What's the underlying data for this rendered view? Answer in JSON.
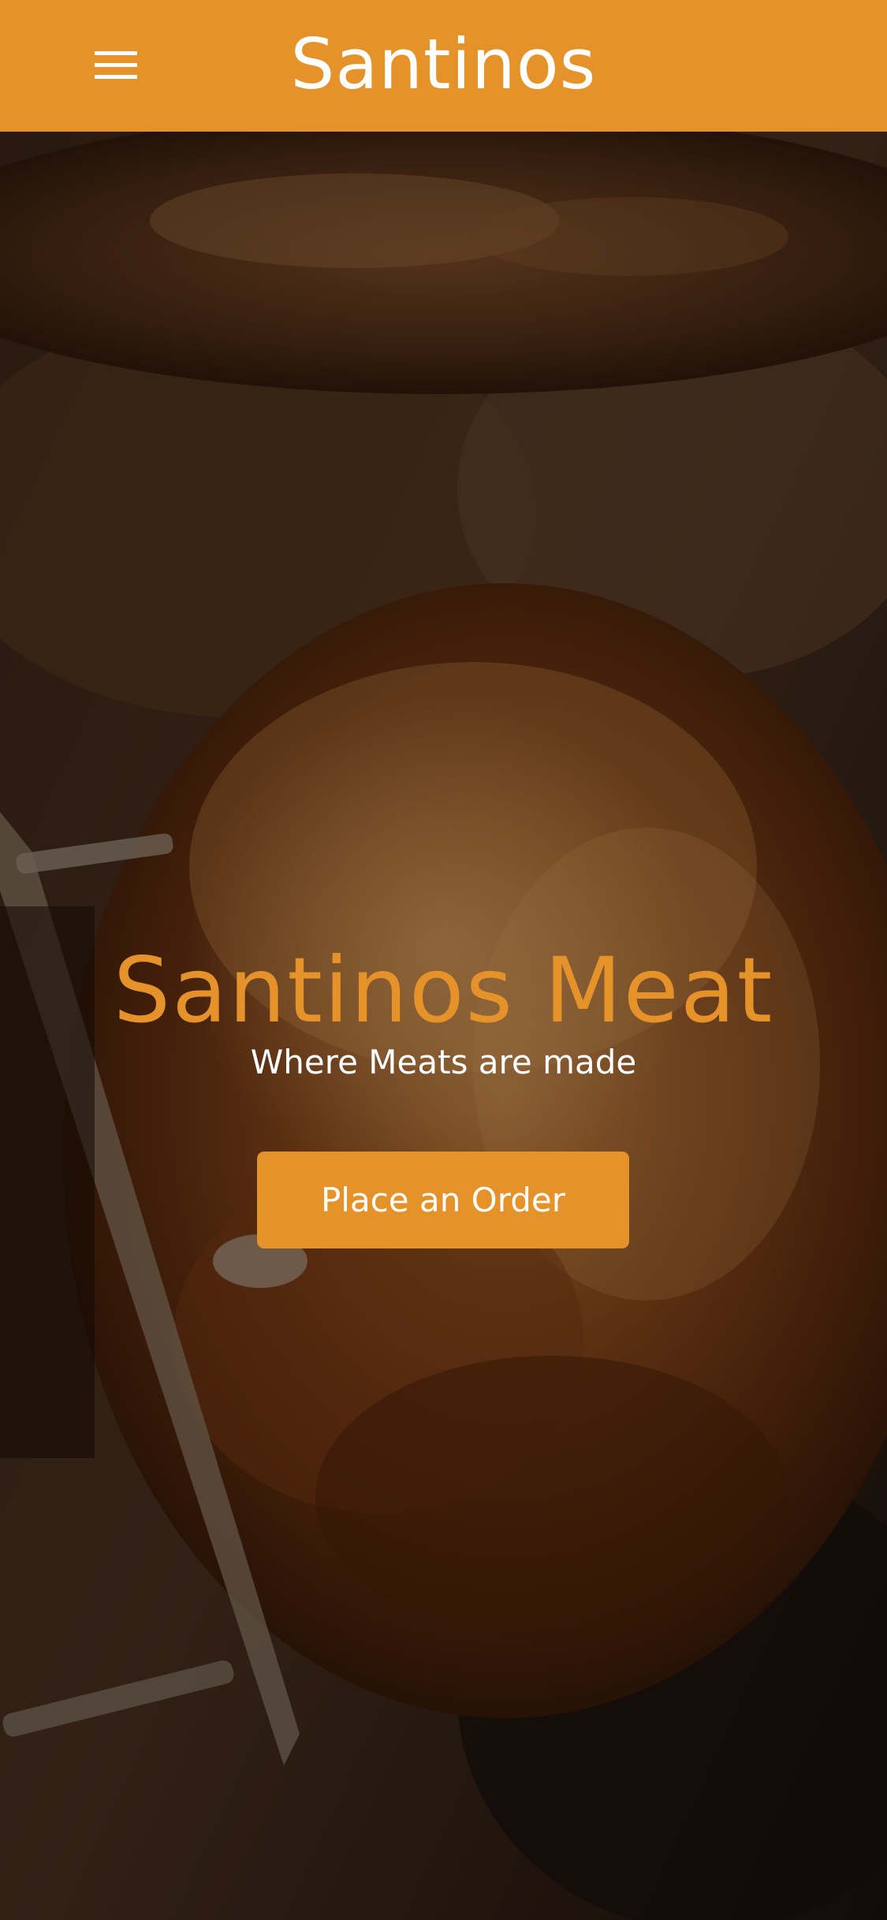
{
  "header": {
    "title": "Santinos",
    "menu_icon": "hamburger-menu-icon"
  },
  "hero": {
    "title": "Santinos Meat",
    "subtitle": "Where Meats are made",
    "cta_label": "Place an Order",
    "background": "photo-roasted-meat-on-spit"
  },
  "colors": {
    "accent": "#e5922a",
    "text_light": "#ffffff"
  }
}
